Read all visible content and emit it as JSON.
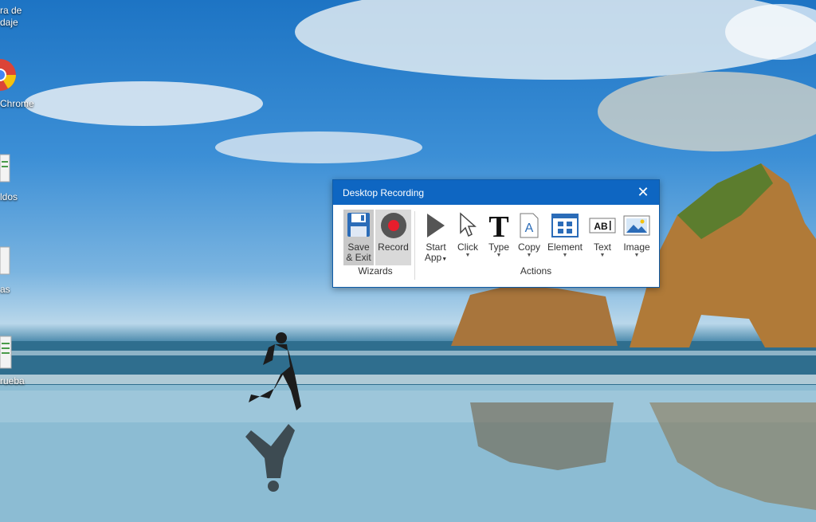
{
  "desktop": {
    "icons": [
      {
        "label_line1": "ra de",
        "label_line2": "daje",
        "icon": "shortcut-icon"
      },
      {
        "label_line1": "Chrome",
        "icon": "chrome-icon"
      },
      {
        "label_line1": "ldos",
        "icon": "spreadsheet-icon"
      },
      {
        "label_line1": "as",
        "icon": "document-icon"
      },
      {
        "label_line1": "rueba",
        "icon": "spreadsheet-icon"
      }
    ]
  },
  "window": {
    "title": "Desktop Recording",
    "close_icon": "close-icon",
    "accent": "#0e66c2",
    "groups": {
      "wizards": {
        "label": "Wizards",
        "buttons": [
          {
            "label_line1": "Save",
            "label_line2": "& Exit",
            "icon": "floppy-disk-icon"
          },
          {
            "label_line1": "Record",
            "icon": "record-icon"
          }
        ]
      },
      "actions": {
        "label": "Actions",
        "buttons": [
          {
            "label_line1": "Start",
            "label_line2": "App",
            "icon": "play-icon"
          },
          {
            "label_line1": "Click",
            "icon": "cursor-icon"
          },
          {
            "label_line1": "Type",
            "icon": "type-icon"
          },
          {
            "label_line1": "Copy",
            "icon": "copy-icon"
          },
          {
            "label_line1": "Element",
            "icon": "element-icon"
          },
          {
            "label_line1": "Text",
            "icon": "text-field-icon"
          },
          {
            "label_line1": "Image",
            "icon": "image-icon"
          }
        ]
      }
    }
  },
  "colors": {
    "record_red": "#e81e2c",
    "ribbon_icon_blue": "#2b6cb8"
  }
}
